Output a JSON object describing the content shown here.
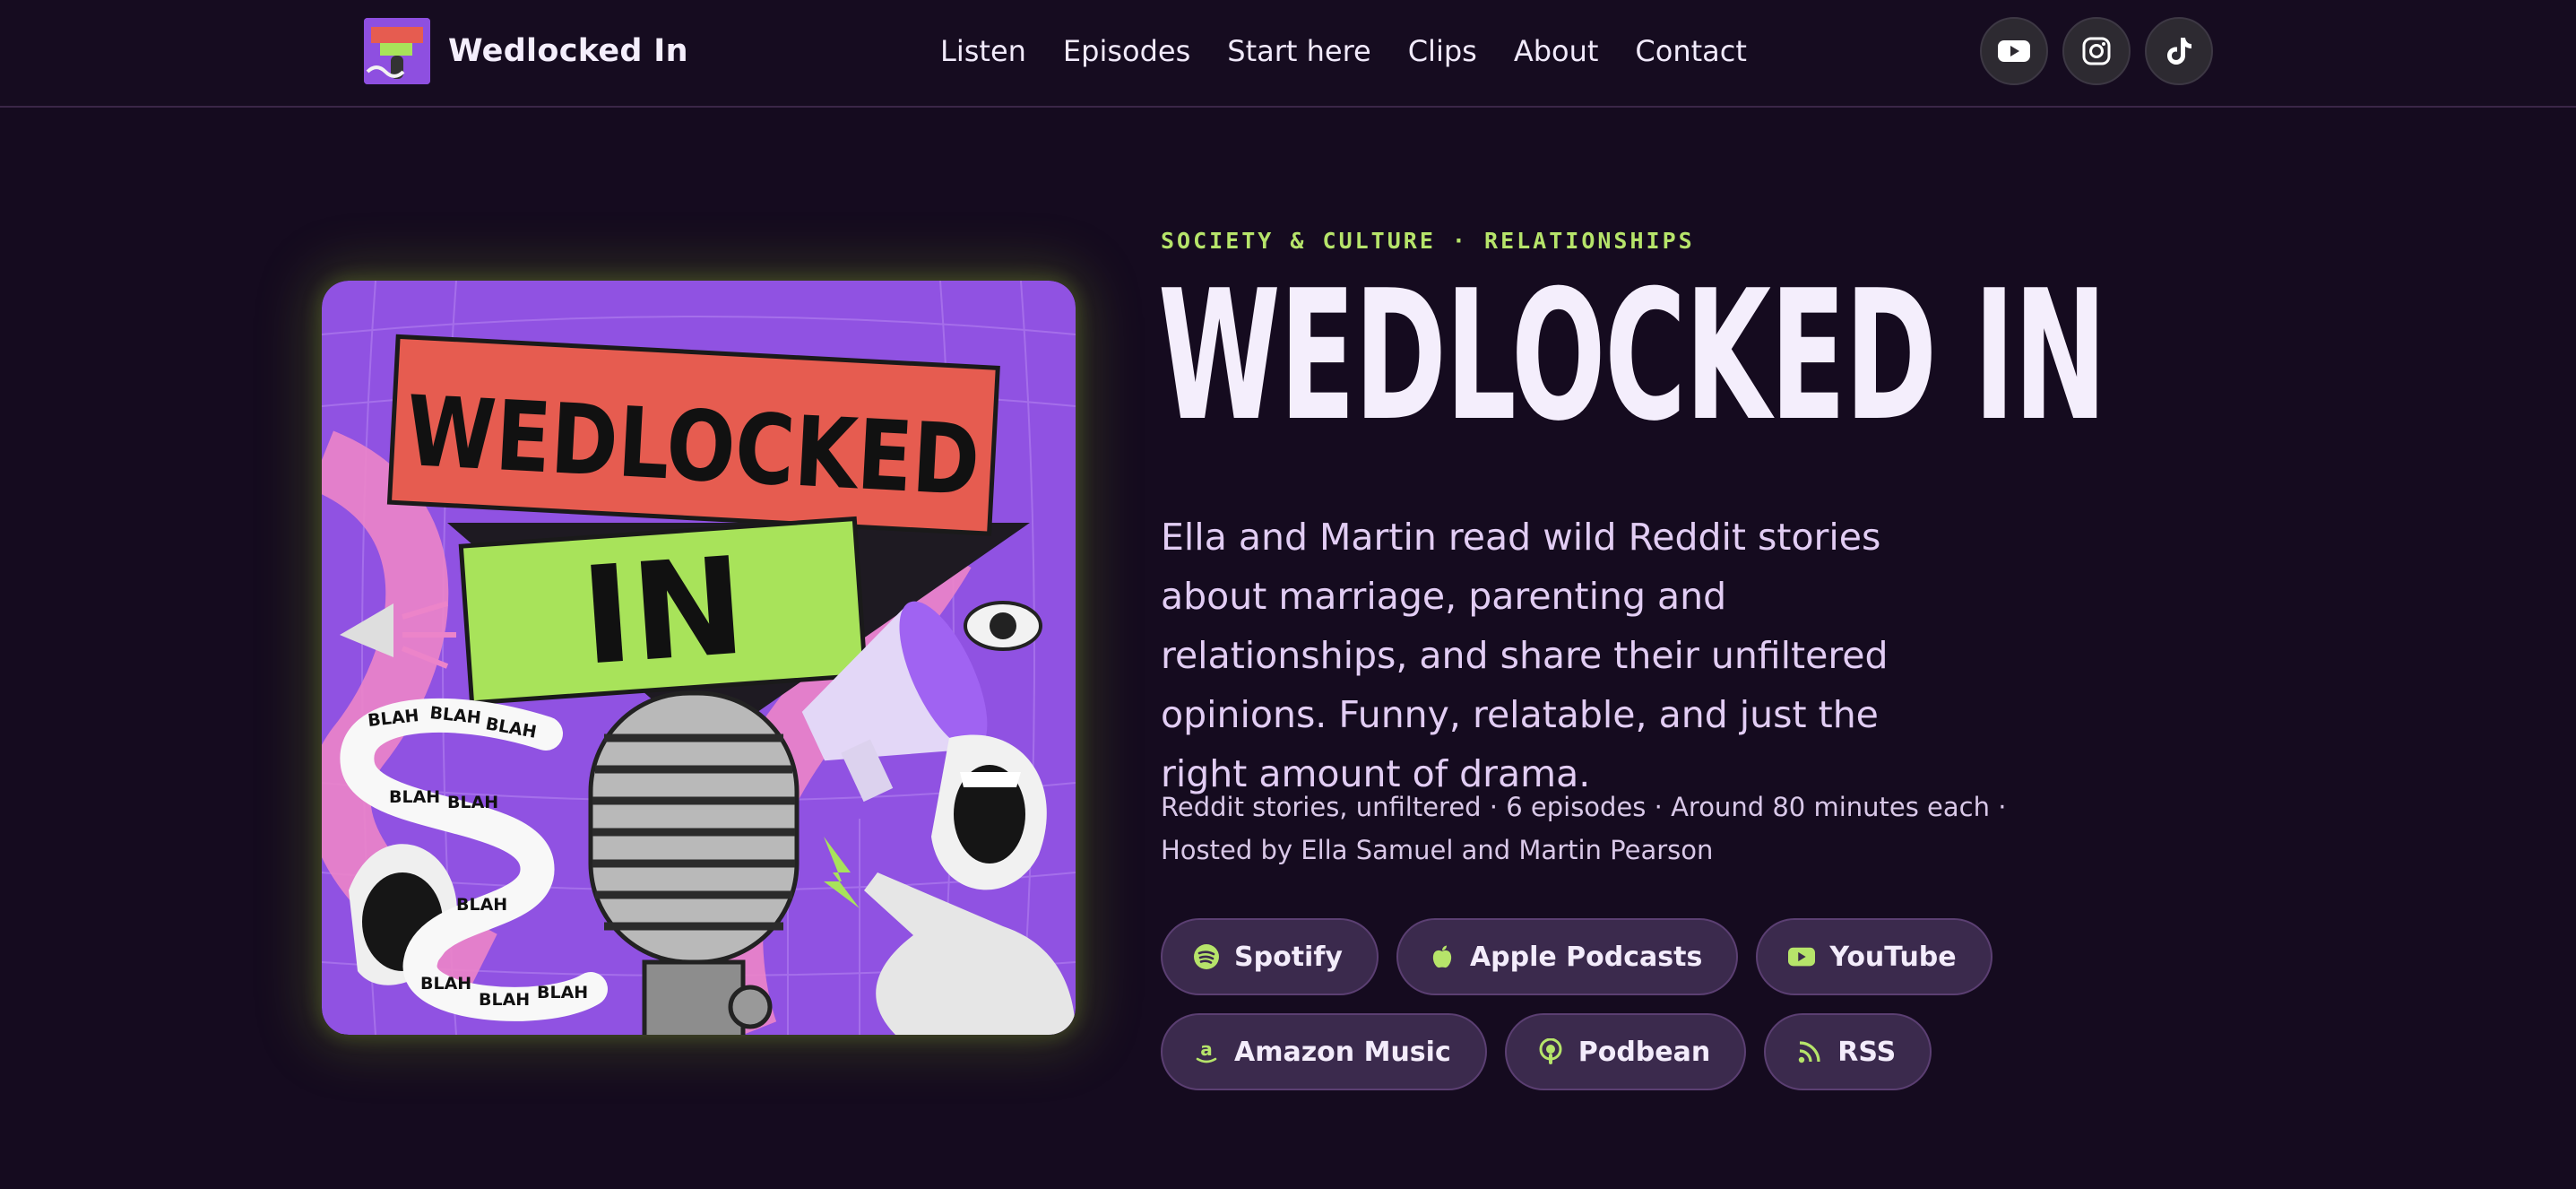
{
  "header": {
    "brand_name": "Wedlocked In",
    "nav": [
      {
        "label": "Listen"
      },
      {
        "label": "Episodes"
      },
      {
        "label": "Start here"
      },
      {
        "label": "Clips"
      },
      {
        "label": "About"
      },
      {
        "label": "Contact"
      }
    ],
    "socials": [
      {
        "icon": "youtube-icon"
      },
      {
        "icon": "instagram-icon"
      },
      {
        "icon": "tiktok-icon"
      }
    ]
  },
  "hero": {
    "eyebrow": "SOCIETY & CULTURE · RELATIONSHIPS",
    "title": "WEDLOCKED IN",
    "description": "Ella and Martin read wild Reddit stories about marriage, parenting and relationships, and share their unfiltered opinions. Funny, relatable, and just the right amount of drama.",
    "meta": "Reddit stories, unfiltered · 6 episodes · Around 80 minutes each · Hosted by Ella Samuel and Martin Pearson",
    "cover": {
      "banner_top": "WEDLOCKED",
      "banner_bottom": "IN",
      "ribbon_word": "BLAH"
    },
    "platforms": [
      {
        "label": "Spotify",
        "icon": "spotify-icon"
      },
      {
        "label": "Apple Podcasts",
        "icon": "apple-icon"
      },
      {
        "label": "YouTube",
        "icon": "youtube-icon"
      },
      {
        "label": "Amazon Music",
        "icon": "amazon-icon"
      },
      {
        "label": "Podbean",
        "icon": "podbean-icon"
      },
      {
        "label": "RSS",
        "icon": "rss-icon"
      }
    ]
  },
  "colors": {
    "background": "#150b1f",
    "accent_green": "#b6e46a",
    "cover_purple": "#8e4fe0",
    "banner_red": "#e65c50",
    "banner_green": "#a8e35a",
    "pill_bg": "#3b2a4d"
  }
}
